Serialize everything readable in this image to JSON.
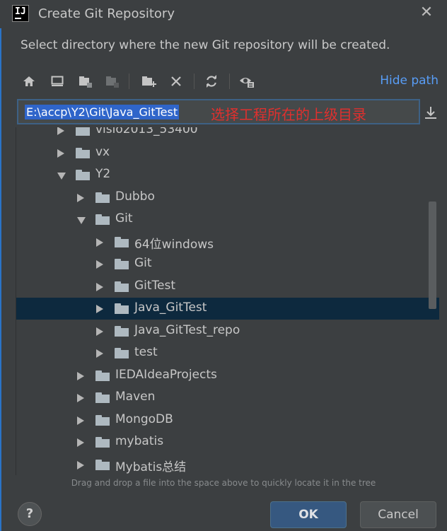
{
  "window": {
    "title": "Create Git Repository"
  },
  "description": "Select directory where the new Git repository will be created.",
  "toolbar": {
    "icons": [
      "home-icon",
      "desktop-icon",
      "project-folder-icon",
      "module-folder-icon",
      "new-folder-icon",
      "delete-icon",
      "refresh-icon",
      "show-hidden-icon"
    ],
    "hide_path_label": "Hide path"
  },
  "path_input": {
    "value": "E:\\accp\\Y2\\Git\\Java_GitTest",
    "annotation": "选择工程所在的上级目录"
  },
  "tree": {
    "items": [
      {
        "label": "visio2013_53400",
        "expanded": false,
        "selected": false
      },
      {
        "label": "vx",
        "expanded": false,
        "selected": false
      },
      {
        "label": "Y2",
        "expanded": true,
        "selected": false
      },
      {
        "label": "Dubbo",
        "expanded": false,
        "selected": false
      },
      {
        "label": "Git",
        "expanded": true,
        "selected": false
      },
      {
        "label": "64位windows",
        "expanded": false,
        "selected": false
      },
      {
        "label": "Git",
        "expanded": false,
        "selected": false
      },
      {
        "label": "GitTest",
        "expanded": false,
        "selected": false
      },
      {
        "label": "Java_GitTest",
        "expanded": false,
        "selected": true
      },
      {
        "label": "Java_GitTest_repo",
        "expanded": false,
        "selected": false
      },
      {
        "label": "test",
        "expanded": false,
        "selected": false
      },
      {
        "label": "IEDAIdeaProjects",
        "expanded": false,
        "selected": false
      },
      {
        "label": "Maven",
        "expanded": false,
        "selected": false
      },
      {
        "label": "MongoDB",
        "expanded": false,
        "selected": false
      },
      {
        "label": "mybatis",
        "expanded": false,
        "selected": false
      },
      {
        "label": "Mybatis总结",
        "expanded": false,
        "selected": false
      }
    ]
  },
  "hint": "Drag and drop a file into the space above to quickly locate it in the tree",
  "footer": {
    "help_label": "?",
    "ok_label": "OK",
    "cancel_label": "Cancel"
  },
  "colors": {
    "background": "#3c3f41",
    "selection": "#0d293e",
    "link": "#589df6",
    "annotation": "#e0302e",
    "ok_button": "#365880"
  }
}
